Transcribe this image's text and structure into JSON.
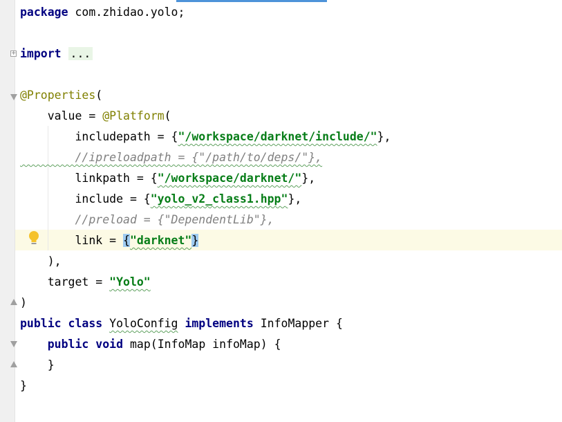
{
  "editor": {
    "lines": [
      [
        {
          "t": "package",
          "c": "kw"
        },
        {
          "t": " com.zhidao.yolo;"
        }
      ],
      [],
      [
        {
          "t": "import",
          "c": "kw"
        },
        {
          "t": " "
        },
        {
          "t": "...",
          "c": "fold-text"
        }
      ],
      [],
      [
        {
          "t": "@Properties",
          "c": "ann"
        },
        {
          "t": "("
        }
      ],
      [
        {
          "t": "    value = "
        },
        {
          "t": "@Platform",
          "c": "ann"
        },
        {
          "t": "("
        }
      ],
      [
        {
          "t": "        includepath = {"
        },
        {
          "t": "\"/workspace/darknet/include/\"",
          "c": "str sq"
        },
        {
          "t": "},"
        }
      ],
      [
        {
          "t": "        //ipreloadpath = {\"/path/to/deps/\"},",
          "c": "cm sq"
        }
      ],
      [
        {
          "t": "        linkpath = {"
        },
        {
          "t": "\"/workspace/darknet/\"",
          "c": "str sq"
        },
        {
          "t": "},"
        }
      ],
      [
        {
          "t": "        include = {"
        },
        {
          "t": "\"yolo_v2_class1.hpp\"",
          "c": "str sq"
        },
        {
          "t": "},"
        }
      ],
      [
        {
          "t": "        //preload = {\"DependentLib\"},",
          "c": "cm"
        }
      ],
      [
        {
          "t": "        link = "
        },
        {
          "t": "{",
          "c": "brace-hl"
        },
        {
          "t": "\"darknet\"",
          "c": "str sq"
        },
        {
          "t": "}",
          "c": "brace-hl"
        }
      ],
      [
        {
          "t": "    ),"
        }
      ],
      [
        {
          "t": "    target = "
        },
        {
          "t": "\"Yolo\"",
          "c": "str sq"
        }
      ],
      [
        {
          "t": ")"
        }
      ],
      [
        {
          "t": "public",
          "c": "kw"
        },
        {
          "t": " "
        },
        {
          "t": "class",
          "c": "kw"
        },
        {
          "t": " "
        },
        {
          "t": "YoloConfig",
          "c": "sq"
        },
        {
          "t": " "
        },
        {
          "t": "implements",
          "c": "kw"
        },
        {
          "t": " InfoMapper {"
        }
      ],
      [
        {
          "t": "    "
        },
        {
          "t": "public",
          "c": "kw"
        },
        {
          "t": " "
        },
        {
          "t": "void",
          "c": "kw"
        },
        {
          "t": " map(InfoMap infoMap) {"
        }
      ],
      [
        {
          "t": "    }"
        }
      ],
      [
        {
          "t": "}"
        }
      ]
    ]
  },
  "icons": {
    "fold_plus": "fold-expand-icon",
    "fold_minus": "fold-collapse-icon",
    "intention": "lightbulb-icon"
  },
  "colors": {
    "keyword": "#000080",
    "string": "#067d17",
    "annotation": "#808000",
    "comment": "#808080",
    "caret_line": "#fcfae5",
    "brace_match": "#9ecbf1",
    "gutter": "#f0f0f0"
  }
}
